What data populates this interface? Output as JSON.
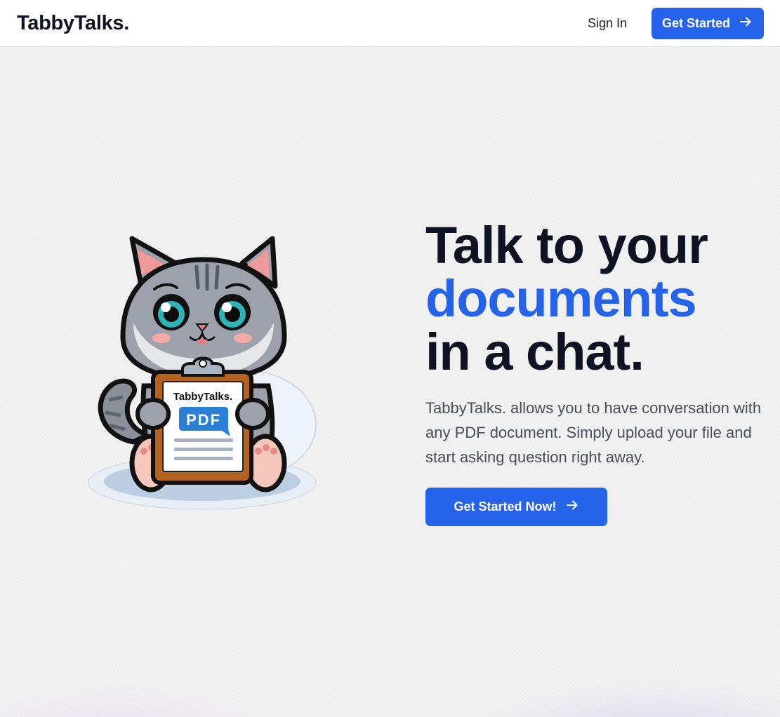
{
  "header": {
    "logo": "TabbyTalks.",
    "signin_label": "Sign In",
    "get_started_label": "Get Started"
  },
  "hero": {
    "title_line1": "Talk to your",
    "title_line2": "documents",
    "title_line3": "in a chat.",
    "description": "TabbyTalks. allows you to have conversation with any PDF document. Simply upload your file and start asking question right away.",
    "cta_label": "Get Started Now!"
  },
  "illustration": {
    "clipboard_brand": "TabbyTalks.",
    "pdf_label": "PDF"
  },
  "colors": {
    "accent": "#2563eb",
    "text_dark": "#0f1222",
    "text_muted": "#4a4d5a"
  },
  "icons": [
    "arrow-right-icon",
    "cat-mascot-illustration"
  ]
}
